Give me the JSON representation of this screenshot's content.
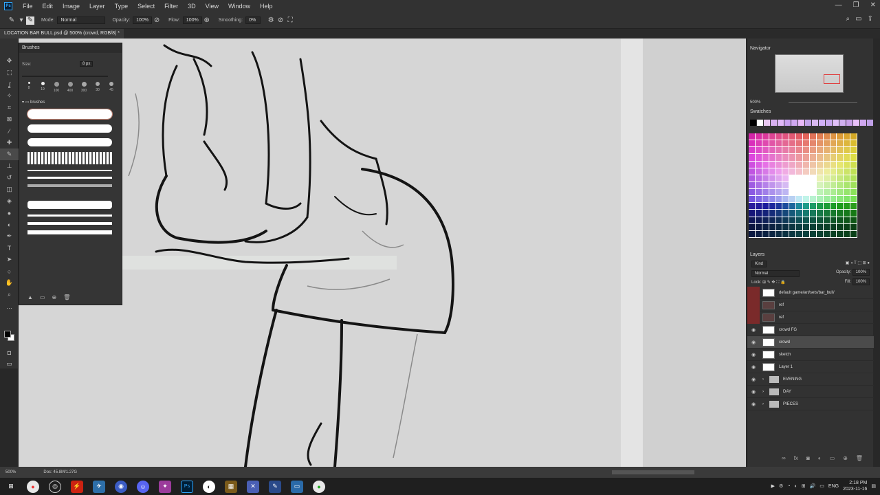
{
  "menu": {
    "app_icon": "Ps",
    "items": [
      "File",
      "Edit",
      "Image",
      "Layer",
      "Type",
      "Select",
      "Filter",
      "3D",
      "View",
      "Window",
      "Help"
    ]
  },
  "options": {
    "mode_label": "Mode:",
    "mode_value": "Normal",
    "opacity_label": "Opacity:",
    "opacity_value": "100%",
    "flow_label": "Flow:",
    "flow_value": "100%",
    "smoothing_label": "Smoothing:",
    "smoothing_value": "0%"
  },
  "document": {
    "tab_title": "LOCATION BAR BULL.psd @ 500% (crowd, RGB/8) *"
  },
  "brushes_panel": {
    "title": "Brushes",
    "size_label": "Size:",
    "size_value": "8 px",
    "presets": [
      "8",
      "19",
      "100",
      "400",
      "300",
      "30",
      "45"
    ],
    "folder_label": "brushes"
  },
  "navigator": {
    "title": "Navigator",
    "zoom": "500%"
  },
  "swatches": {
    "title": "Swatches",
    "top_row_colors": [
      "#000000",
      "#ffffff",
      "#e8c8f0",
      "#d8b0f0",
      "#e0b8f8",
      "#c8a0f0",
      "#d0a8f0",
      "#e8b8f8",
      "#c0a0e8",
      "#d8b8f0",
      "#d0b0f8",
      "#c8a8f0",
      "#e0c0f8",
      "#d0b0f0",
      "#c8a0e8",
      "#e8c0f8",
      "#d0a8f0",
      "#c0a0e8"
    ]
  },
  "layers": {
    "title": "Layers",
    "filter_label": "Kind",
    "blend_mode": "Normal",
    "opacity_label": "Opacity:",
    "opacity_value": "100%",
    "lock_label": "Lock:",
    "fill_label": "Fill:",
    "fill_value": "100%",
    "items": [
      {
        "name": "default game/art/sets/bar_bull/",
        "type": "layer",
        "visible": false,
        "thumb": "light",
        "selected": false
      },
      {
        "name": "ref",
        "type": "layer",
        "visible": false,
        "thumb": "dark",
        "selected": false
      },
      {
        "name": "ref",
        "type": "layer",
        "visible": false,
        "thumb": "dark",
        "selected": false
      },
      {
        "name": "crowd FG",
        "type": "layer",
        "visible": true,
        "thumb": "light",
        "selected": false
      },
      {
        "name": "crowd",
        "type": "layer",
        "visible": true,
        "thumb": "light",
        "selected": true
      },
      {
        "name": "sketch",
        "type": "layer",
        "visible": true,
        "thumb": "light",
        "selected": false
      },
      {
        "name": "Layer 1",
        "type": "layer",
        "visible": true,
        "thumb": "light",
        "selected": false
      },
      {
        "name": "EVENING",
        "type": "group",
        "visible": true,
        "selected": false
      },
      {
        "name": "DAY",
        "type": "group",
        "visible": true,
        "selected": false
      },
      {
        "name": "PIECES",
        "type": "group",
        "visible": true,
        "selected": false
      }
    ]
  },
  "status": {
    "zoom": "500%",
    "doc": "Doc: 45.8M/1.27G"
  },
  "taskbar": {
    "time": "2:18 PM",
    "date": "2023-11-16",
    "lang": "ENG"
  }
}
